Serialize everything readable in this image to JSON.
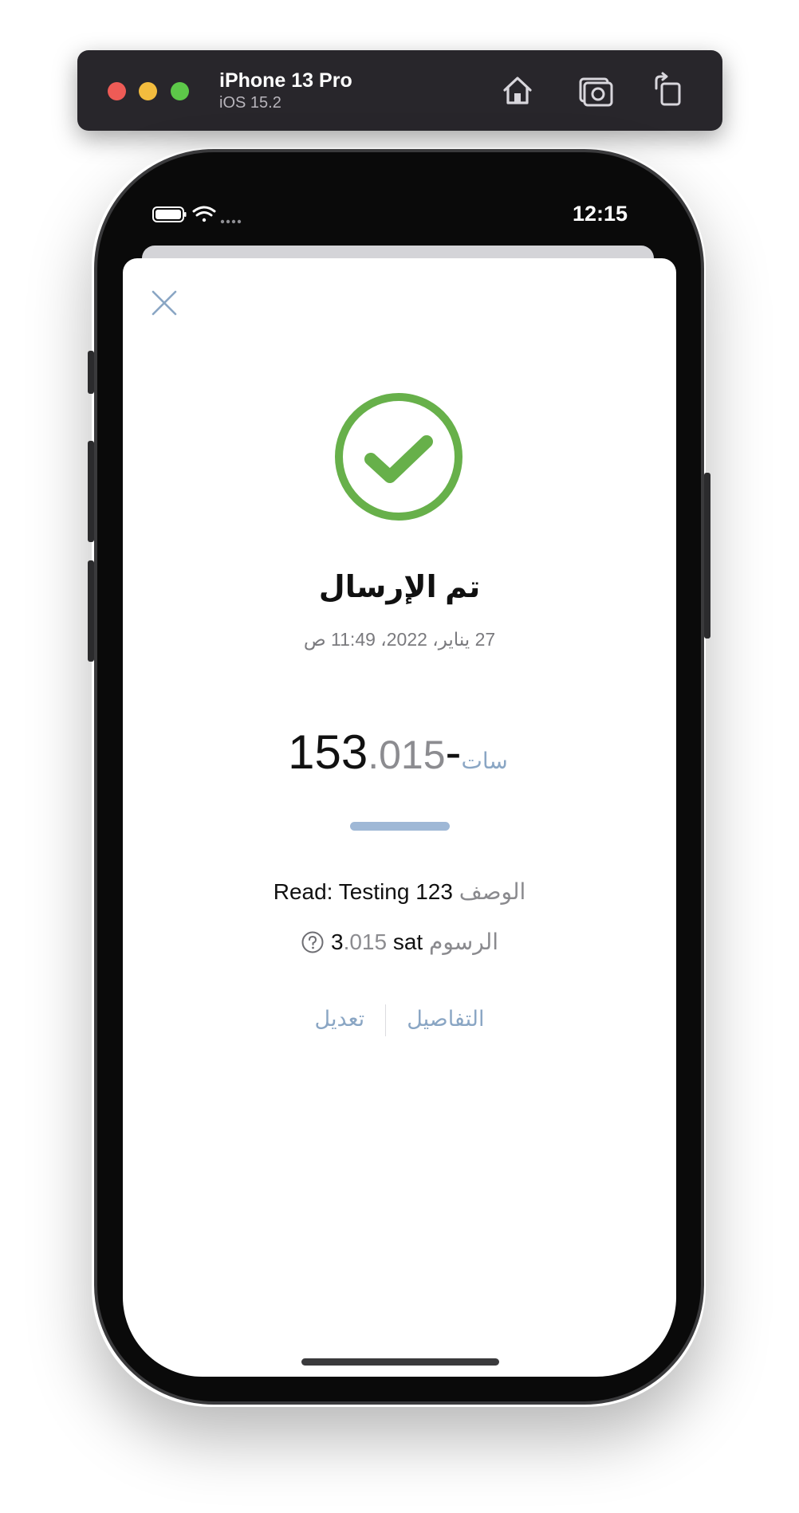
{
  "simulator": {
    "device_name": "iPhone 13 Pro",
    "os_version": "iOS 15.2"
  },
  "status_bar": {
    "time": "12:15"
  },
  "sheet": {
    "title": "تم الإرسال",
    "datetime": "27 يناير، 2022، 11:49 ص",
    "amount": {
      "main": "-153",
      "fraction": ".015",
      "unit": "سات"
    },
    "description": {
      "label": "الوصف",
      "value": "Read: Testing 123"
    },
    "fee": {
      "label": "الرسوم",
      "value_main": "3",
      "value_fraction": ".015",
      "unit": "sat"
    },
    "actions": {
      "details": "التفاصيل",
      "edit": "تعديل"
    }
  },
  "colors": {
    "success_green": "#67b04a",
    "accent_blue": "#8aa6c4",
    "bar_blue": "#9fb8d6"
  },
  "icons": {
    "close": "close-icon",
    "success": "checkmark-circle-icon",
    "help": "question-circle-icon",
    "home": "home-icon",
    "screenshot": "camera-icon",
    "rotate": "rotate-icon",
    "battery": "battery-icon",
    "wifi": "wifi-icon"
  }
}
